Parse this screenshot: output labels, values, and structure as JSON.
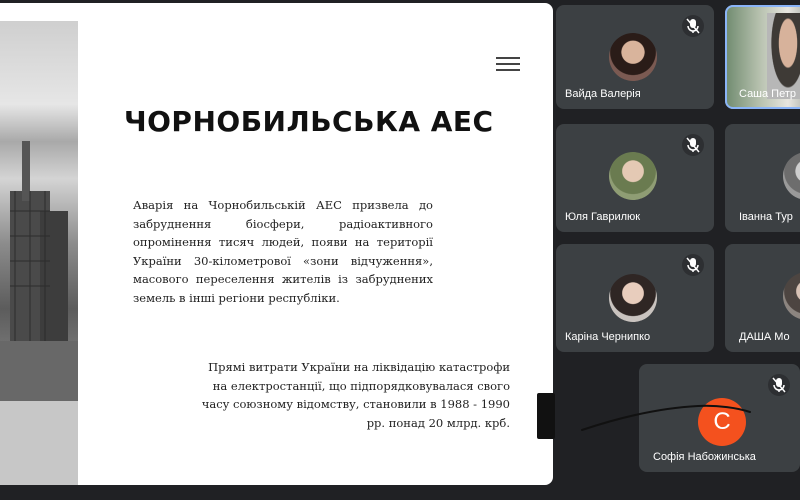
{
  "slide": {
    "title": "ЧОРНОБИЛЬСЬКА АЕС",
    "paragraph1": "Аварія на Чорнобильській АЕС призвела до забруднення біосфери, радіоактивного опромінення тисяч людей, появи на території України 30-кілометрової «зони відчуження», масового переселення жителів із забруднених земель в інші регіони республіки.",
    "paragraph2": "Прямі витрати України на ліквідацію катастрофи на електростанції, що підпорядковувалася свого часу союзному відомству, становили в 1988 - 1990 рр. понад 20 млрд. крб."
  },
  "participants": [
    {
      "name": "Вайда Валерія",
      "muted": true
    },
    {
      "name": "Саша Петр",
      "muted": false
    },
    {
      "name": "Юля Гаврилюк",
      "muted": true
    },
    {
      "name": "Іванна Тур",
      "muted": false
    },
    {
      "name": "Каріна Чернипко",
      "muted": true
    },
    {
      "name": "ДАША Мо",
      "muted": false
    },
    {
      "name": "Софія Набожинська",
      "muted": true,
      "avatar_letter": "С",
      "avatar_color": "#f4511e"
    }
  ],
  "colors": {
    "background": "#202124",
    "tile": "#3c4043",
    "active_speaker_border": "#8ab4f8"
  }
}
